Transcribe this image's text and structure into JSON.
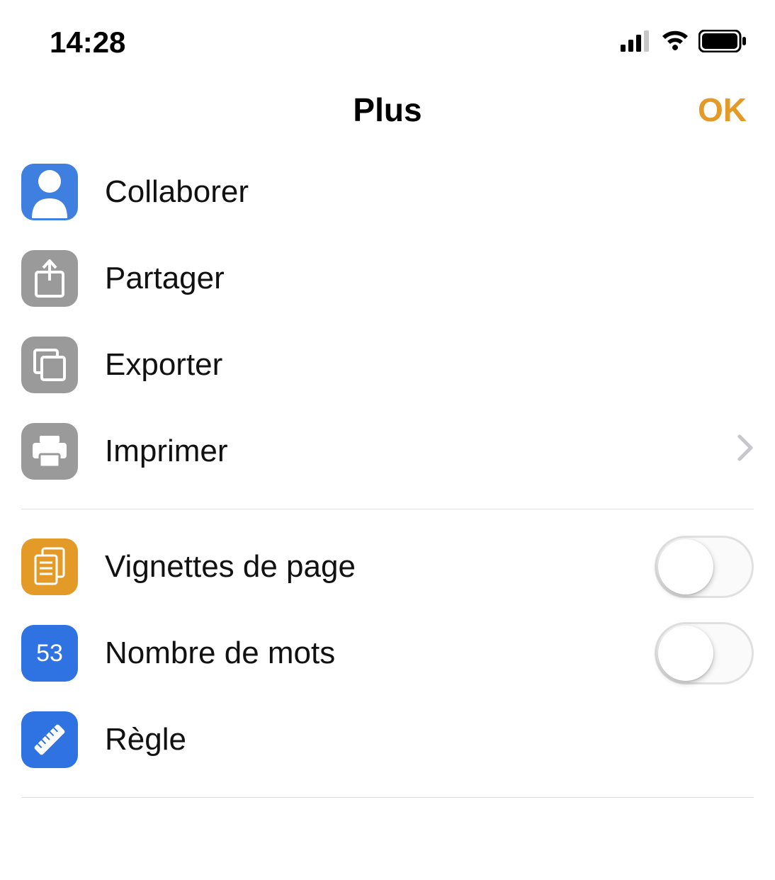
{
  "status": {
    "time": "14:28"
  },
  "nav": {
    "title": "Plus",
    "ok": "OK"
  },
  "rows": {
    "collaborate": "Collaborer",
    "share": "Partager",
    "export": "Exporter",
    "print": "Imprimer",
    "thumbnails": "Vignettes de page",
    "wordcount": "Nombre de mots",
    "wordcount_badge": "53",
    "ruler": "Règle"
  },
  "toggles": {
    "thumbnails": false,
    "wordcount": false
  }
}
